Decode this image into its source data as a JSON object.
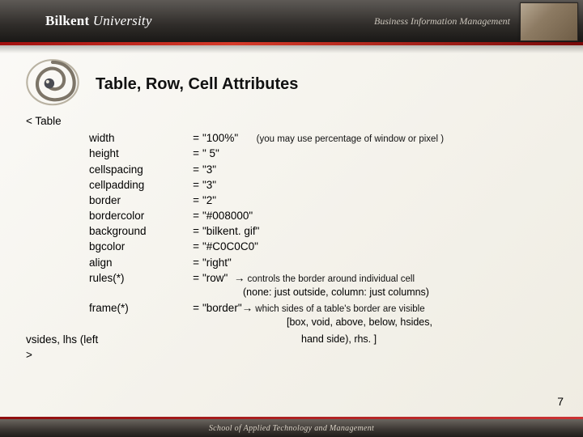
{
  "header": {
    "university_prefix": "Bilkent ",
    "university_suffix": "University",
    "subtitle": "Business Information Management"
  },
  "title": "Table, Row, Cell Attributes",
  "open_tag": "< Table",
  "attrs": [
    {
      "name": "width",
      "eq": "=",
      "val": "\"100%\"",
      "extra": "(you may use percentage of window or pixel )"
    },
    {
      "name": "height",
      "eq": "=",
      "val": "\" 5\""
    },
    {
      "name": "cellspacing",
      "eq": "=",
      "val": "\"3\""
    },
    {
      "name": "cellpadding",
      "eq": "=",
      "val": "\"3\""
    },
    {
      "name": "border",
      "eq": "=",
      "val": "\"2\""
    },
    {
      "name": "bordercolor",
      "eq": "=",
      "val": "\"#008000\""
    },
    {
      "name": "background",
      "eq": "=",
      "val": "\"bilkent. gif\""
    },
    {
      "name": "bgcolor",
      "eq": "=",
      "val": "\"#C0C0C0\""
    },
    {
      "name": "align",
      "eq": "=",
      "val": "\"right\""
    }
  ],
  "rules": {
    "name": "rules(*)",
    "eq": "=",
    "val": "\"row\"",
    "arrow": "→",
    "desc": " controls the border around individual cell",
    "sub": "(none: just outside, column: just columns)"
  },
  "frame": {
    "name": "frame(*)",
    "eq": "=",
    "val": "\"border\"",
    "arrow": "→",
    "desc": " which sides of a table's border are visible",
    "sub1": "[box, void, above, below, hsides,",
    "sub2": "hand side), rhs. ]"
  },
  "close_prefix": "vsides, lhs (left",
  "close_tag": ">",
  "footer_text": "School of Applied Technology and Management",
  "page_number": "7"
}
